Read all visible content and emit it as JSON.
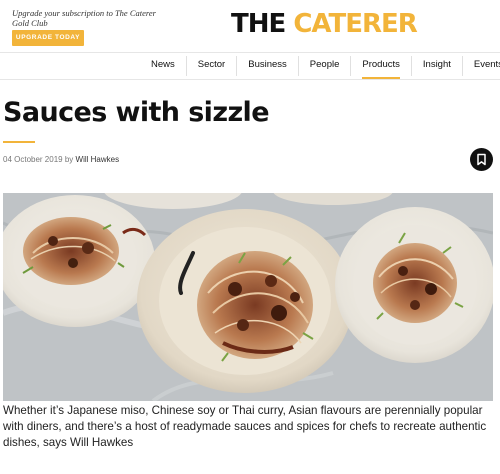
{
  "header": {
    "promo_text": "Upgrade your subscription to The Caterer Gold Club",
    "upgrade_button": "UPGRADE TODAY",
    "logo_word_1": "THE",
    "logo_word_2": "CATERER",
    "brand_color": "#f2b43a"
  },
  "nav": {
    "items": [
      {
        "label": "News"
      },
      {
        "label": "Sector"
      },
      {
        "label": "Business"
      },
      {
        "label": "People"
      },
      {
        "label": "Products",
        "active": true
      },
      {
        "label": "Insight"
      },
      {
        "label": "Events"
      }
    ]
  },
  "article": {
    "headline": "Sauces with sizzle",
    "date": "04 October 2019",
    "by": "by",
    "author": "Will Hawkes",
    "bookmark_icon": "bookmark-icon",
    "image_description_icon": "hero-photo",
    "standfirst": "Whether it’s Japanese miso, Chinese soy or Thai curry, Asian flavours are perennially popular with diners, and there’s a host of readymade sauces and spices for chefs to recreate authentic dishes, says Will Hawkes"
  }
}
